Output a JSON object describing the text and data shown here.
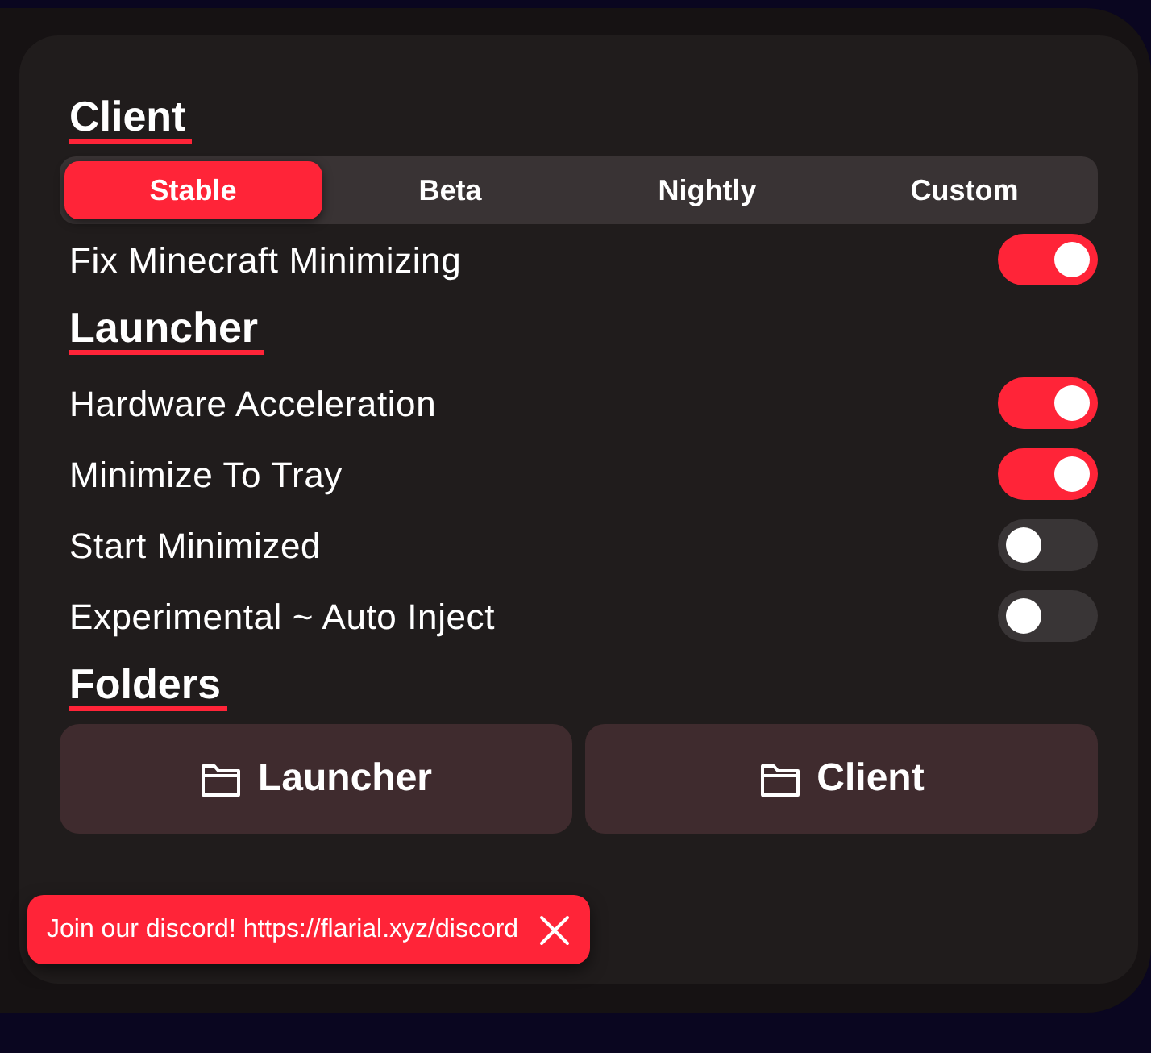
{
  "sections": [
    {
      "title": "Client",
      "items": [
        {
          "kind": "tabs",
          "tabs": [
            {
              "label": "Stable",
              "selected": true
            },
            {
              "label": "Beta",
              "selected": false
            },
            {
              "label": "Nightly",
              "selected": false
            },
            {
              "label": "Custom",
              "selected": false
            }
          ]
        },
        {
          "kind": "toggle",
          "label": "Fix Minecraft Minimizing",
          "on": true
        }
      ]
    },
    {
      "title": "Launcher",
      "items": [
        {
          "kind": "toggle",
          "label": "Hardware Acceleration",
          "on": true
        },
        {
          "kind": "toggle",
          "label": "Minimize To Tray",
          "on": true
        },
        {
          "kind": "toggle",
          "label": "Start Minimized",
          "on": false
        },
        {
          "kind": "toggle",
          "label": "Experimental ~ Auto Inject",
          "on": false
        }
      ]
    },
    {
      "title": "Folders",
      "items": [
        {
          "kind": "folders",
          "buttons": [
            "Launcher",
            "Client"
          ]
        }
      ]
    }
  ],
  "toast": {
    "text": "Join our discord! https://flarial.xyz/discord"
  }
}
